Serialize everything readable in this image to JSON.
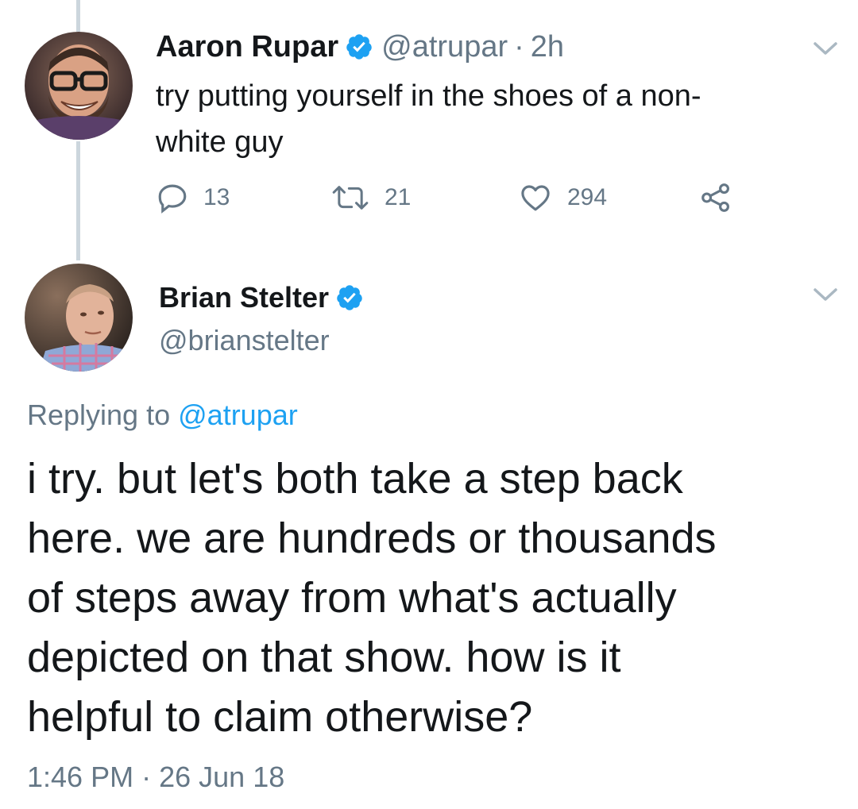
{
  "colors": {
    "text": "#14171a",
    "muted": "#657786",
    "link": "#1da1f2",
    "verified": "#1da1f2",
    "thread_line": "#ccd6dd"
  },
  "tweet1": {
    "display_name": "Aaron Rupar",
    "handle": "@atrupar",
    "separator": "·",
    "time": "2h",
    "text": "try putting yourself in the shoes of a non-white guy",
    "text_line1": "try putting yourself in the shoes of a non-",
    "text_line2": "white guy",
    "icons": {
      "avatar": "avatar",
      "verified": "verified-badge-icon",
      "menu": "chevron-down-icon",
      "reply": "reply-icon",
      "retweet": "retweet-icon",
      "like": "heart-icon",
      "share": "share-icon"
    },
    "replies": "13",
    "retweets": "21",
    "likes": "294"
  },
  "tweet2": {
    "display_name": "Brian Stelter",
    "handle": "@brianstelter",
    "replying_prefix": "Replying to",
    "replying_to": "@atrupar",
    "text": "i try. but let's both take a step back here. we are hundreds or thousands of steps away from what's actually depicted on that show. how is it helpful to claim otherwise?",
    "lines": [
      "i try. but let's both take a step back",
      "here. we are hundreds or thousands",
      "of steps away from what's actually",
      "depicted on that show. how is it",
      "helpful to claim otherwise?"
    ],
    "timestamp_time": "1:46 PM",
    "timestamp_separator": "·",
    "timestamp_date": "26 Jun 18"
  }
}
